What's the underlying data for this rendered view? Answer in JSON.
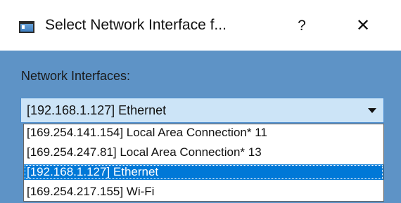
{
  "dialog": {
    "title": "Select Network Interface f...",
    "help_glyph": "?",
    "close_glyph": "✕",
    "icon": "app-window-icon"
  },
  "form": {
    "label": "Network Interfaces:"
  },
  "combobox": {
    "selected_value": "[192.168.1.127] Ethernet",
    "options": [
      "[169.254.141.154] Local Area Connection* 11",
      "[169.254.247.81] Local Area Connection* 13",
      "[192.168.1.127] Ethernet",
      "[169.254.217.155] Wi-Fi"
    ],
    "highlighted_index": 2
  },
  "colors": {
    "client_area": "#5e93c6",
    "combo_background": "#cce4f7",
    "selection_highlight": "#0078d7"
  }
}
